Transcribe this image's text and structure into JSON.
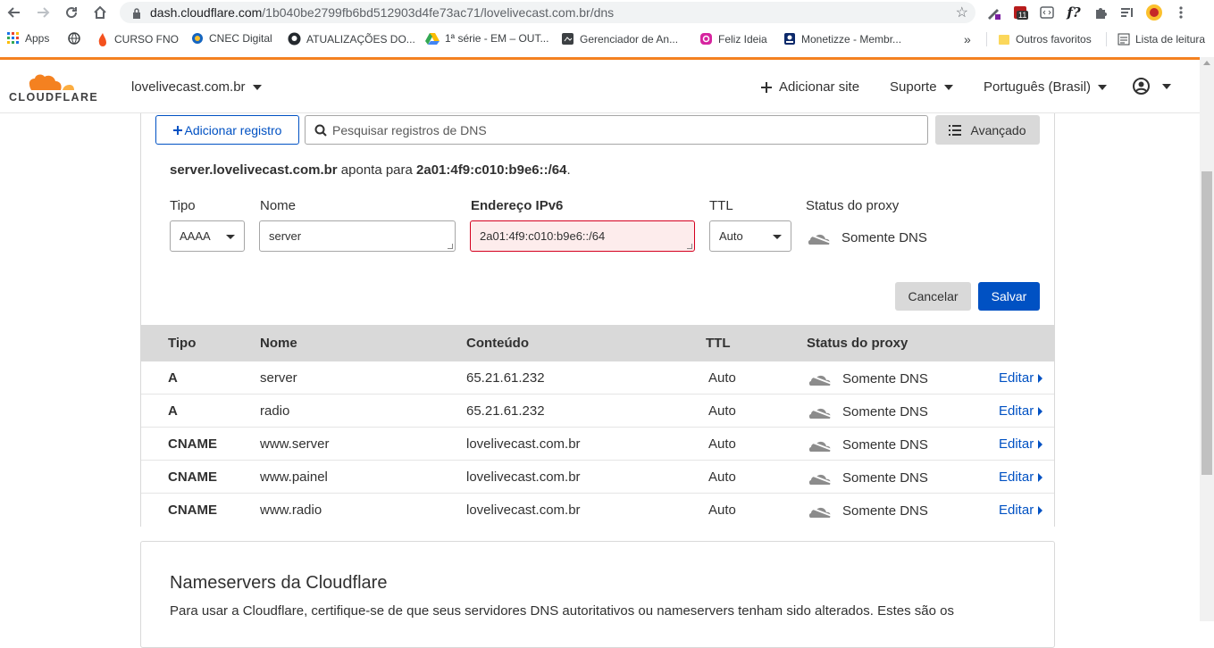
{
  "browser": {
    "url_host": "dash.cloudflare.com",
    "url_path": "/1b040be2799fb6bd512903d4fe73ac71/lovelivecast.com.br/dns",
    "ext_badge": "11",
    "ext_label_f": "f?",
    "bookmarks": [
      {
        "label": "Apps"
      },
      {
        "label": ""
      },
      {
        "label": "CURSO FNO"
      },
      {
        "label": "CNEC Digital"
      },
      {
        "label": "ATUALIZAÇÕES DO..."
      },
      {
        "label": "1ª série - EM – OUT..."
      },
      {
        "label": "Gerenciador de An..."
      },
      {
        "label": "Feliz Ideia"
      },
      {
        "label": "Monetizze - Membr..."
      }
    ],
    "overflow": "»",
    "other_favorites": "Outros favoritos",
    "reading_list": "Lista de leitura"
  },
  "header": {
    "logo_text": "CLOUDFLARE",
    "site": "lovelivecast.com.br",
    "add_site": "Adicionar site",
    "support": "Suporte",
    "language": "Português (Brasil)"
  },
  "toolbar": {
    "add_record": "Adicionar registro",
    "search_placeholder": "Pesquisar registros de DNS",
    "advanced": "Avançado"
  },
  "form": {
    "points_name": "server.lovelivecast.com.br",
    "points_mid": " aponta para ",
    "points_target": "2a01:4f9:c010:b9e6::/64",
    "points_end": ".",
    "labels": {
      "type": "Tipo",
      "name": "Nome",
      "address": "Endereço IPv6",
      "ttl": "TTL",
      "proxy": "Status do proxy"
    },
    "type_value": "AAAA",
    "name_value": "server",
    "address_value": "2a01:4f9:c010:b9e6::/64",
    "ttl_value": "Auto",
    "proxy_value": "Somente DNS",
    "cancel": "Cancelar",
    "save": "Salvar"
  },
  "table": {
    "headers": [
      "Tipo",
      "Nome",
      "Conteúdo",
      "TTL",
      "Status do proxy"
    ],
    "edit_label": "Editar",
    "rows": [
      {
        "type": "A",
        "name": "server",
        "content": "65.21.61.232",
        "ttl": "Auto",
        "proxy": "Somente DNS"
      },
      {
        "type": "A",
        "name": "radio",
        "content": "65.21.61.232",
        "ttl": "Auto",
        "proxy": "Somente DNS"
      },
      {
        "type": "CNAME",
        "name": "www.server",
        "content": "lovelivecast.com.br",
        "ttl": "Auto",
        "proxy": "Somente DNS"
      },
      {
        "type": "CNAME",
        "name": "www.painel",
        "content": "lovelivecast.com.br",
        "ttl": "Auto",
        "proxy": "Somente DNS"
      },
      {
        "type": "CNAME",
        "name": "www.radio",
        "content": "lovelivecast.com.br",
        "ttl": "Auto",
        "proxy": "Somente DNS"
      }
    ]
  },
  "nameservers": {
    "title": "Nameservers da Cloudflare",
    "text": "Para usar a Cloudflare, certifique-se de que seus servidores DNS autoritativos ou nameservers tenham sido alterados. Estes são os"
  },
  "colors": {
    "accent_orange": "#f48120",
    "primary_blue": "#0051c3",
    "error_red": "#d4001f"
  }
}
